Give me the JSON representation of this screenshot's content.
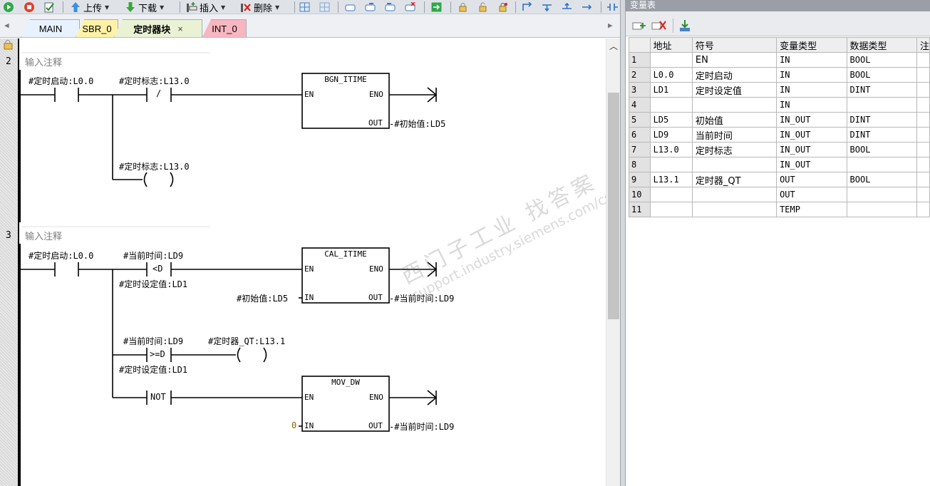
{
  "toolbar": {
    "upload_label": "上传",
    "download_label": "下载",
    "insert_label": "插入",
    "delete_label": "删除"
  },
  "tabs": [
    {
      "label": "MAIN",
      "color": "#e8f2ff"
    },
    {
      "label": "SBR_0",
      "color": "#fff2a8"
    },
    {
      "label": "定时器块",
      "color": "#e9f3d4",
      "active": true
    },
    {
      "label": "INT_0",
      "color": "#f7b6c0"
    }
  ],
  "tab_close_glyph": "×",
  "networks": [
    {
      "number": "2",
      "comment": "输入注释",
      "labels": {
        "contact1": "#定时启动:L0.0",
        "contact2": "#定时标志:L13.0",
        "contact2_sym": "/",
        "coil": "#定时标志:L13.0",
        "box_title": "BGN_ITIME",
        "en": "EN",
        "eno": "ENO",
        "out": "OUT",
        "out_var": "#初始值:LD5"
      }
    },
    {
      "number": "3",
      "comment": "输入注释",
      "labels": {
        "contact1": "#定时启动:L0.0",
        "cmp1_top": "#当前时间:LD9",
        "cmp1_sym": "<D",
        "cmp1_bottom": "#定时设定值:LD1",
        "box1_title": "CAL_ITIME",
        "box1_en": "EN",
        "box1_eno": "ENO",
        "box1_in": "IN",
        "box1_in_var": "#初始值:LD5",
        "box1_out": "OUT",
        "box1_out_var": "#当前时间:LD9",
        "cmp2_top": "#当前时间:LD9",
        "cmp2_sym": ">=D",
        "cmp2_bottom": "#定时设定值:LD1",
        "coil2": "#定时器_QT:L13.1",
        "not_sym": "NOT",
        "box2_title": "MOV_DW",
        "box2_en": "EN",
        "box2_eno": "ENO",
        "box2_in": "IN",
        "box2_in_var": "0",
        "box2_out": "OUT",
        "box2_out_var": "#当前时间:LD9"
      }
    }
  ],
  "watermark": {
    "line1": "西门子工业  找答案",
    "line2": "support.industry.siemens.com/cs"
  },
  "var_table": {
    "title": "变量表",
    "headers": [
      "",
      "地址",
      "符号",
      "变量类型",
      "数据类型",
      "注"
    ],
    "rows": [
      [
        "1",
        "",
        "EN",
        "IN",
        "BOOL"
      ],
      [
        "2",
        "L0.0",
        "定时启动",
        "IN",
        "BOOL"
      ],
      [
        "3",
        "LD1",
        "定时设定值",
        "IN",
        "DINT"
      ],
      [
        "4",
        "",
        "",
        "IN",
        ""
      ],
      [
        "5",
        "LD5",
        "初始值",
        "IN_OUT",
        "DINT"
      ],
      [
        "6",
        "LD9",
        "当前时间",
        "IN_OUT",
        "DINT"
      ],
      [
        "7",
        "L13.0",
        "定时标志",
        "IN_OUT",
        "BOOL"
      ],
      [
        "8",
        "",
        "",
        "IN_OUT",
        ""
      ],
      [
        "9",
        "L13.1",
        "定时器_QT",
        "OUT",
        "BOOL"
      ],
      [
        "10",
        "",
        "",
        "OUT",
        ""
      ],
      [
        "11",
        "",
        "",
        "TEMP",
        ""
      ]
    ]
  }
}
